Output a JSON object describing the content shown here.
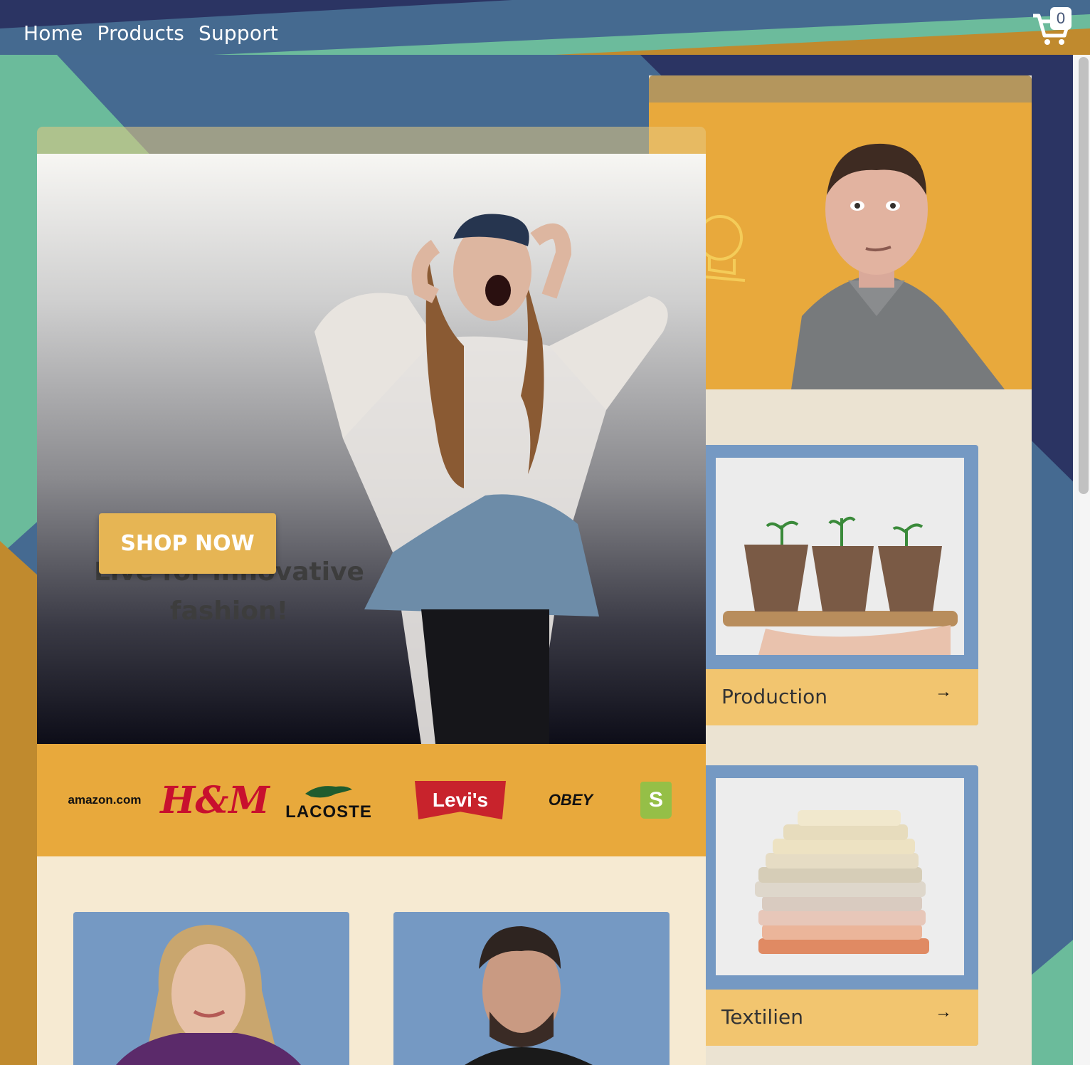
{
  "nav": {
    "links": [
      "Home",
      "Products",
      "Support"
    ],
    "cart_count": "0"
  },
  "hero": {
    "headline": "Live for innovative fashion!",
    "cta": "SHOP NOW"
  },
  "brands": {
    "logos": [
      "amazon.com",
      "H&M",
      "LACOSTE",
      "Levi's",
      "OBEY",
      "S"
    ]
  },
  "categories": [
    {
      "label": "Production",
      "arrow": "→"
    },
    {
      "label": "Textilien",
      "arrow": "→"
    }
  ],
  "colors": {
    "accent": "#e8a93c",
    "button": "#e6b554",
    "card_blue": "#7599c3",
    "nav_teal": "#6cbb9c",
    "nav_blue": "#466a90"
  }
}
